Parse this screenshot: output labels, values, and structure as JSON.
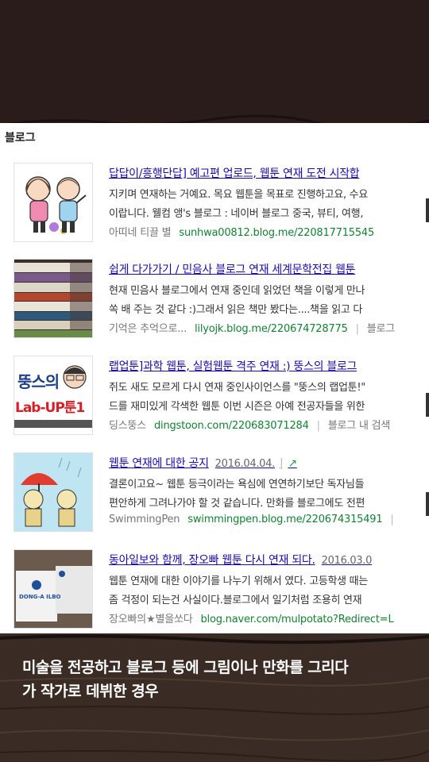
{
  "section": {
    "title": "블로그"
  },
  "results": [
    {
      "title": "답답이/흥행단답] 예고편 업로드, 웹툰 연재 도전 시작합",
      "line1": "지키며 연재하는 거예요. 목요 웹툰을 목표로 진행하고요, 수요",
      "line2": "이랍니다. 웰컴 앵's 블로그 : 네이버 블로그 중국, 뷰티, 여행,",
      "author": "아띠네 티끌 별",
      "url": "sunhwa00812.blog.me/220817715545",
      "thumb_icon": "cartoon-couple-thumbnail"
    },
    {
      "title": "쉽게 다가가기 / 민음사 블로그 연재 세계문학전집 웹툰",
      "line1": "현재 민음사 블로그에서 연재 중인데 읽었던 책을 이렇게 만나",
      "line2": "쏙 배 주는 것 같다 :)그래서 읽은 책만 봤다는....책을 읽고 다",
      "author": "기억은 추억으로...",
      "url": "lilyojk.blog.me/220674728775",
      "extra": "블로그",
      "thumb_icon": "bookshelf-thumbnail"
    },
    {
      "title": "랩업툰]과학 웹툰, 실험웹툰 격주 연재 :) 뚱스의 블로그",
      "line1": "쥐도 새도 모르게 다시 연재 중인사이언스를 \"뚱스의 랩업툰!\"",
      "line2": "드를 재미있게 각색한 웹툰 이번 시즌은 아예 전공자들을 위한",
      "author": "딩스뚱스",
      "url": "dingstoon.com/220683071284",
      "extra": "블로그 내 검색",
      "thumb_icon": "lab-up-toon-thumbnail",
      "thumb_text_top": "뚱스의",
      "thumb_text_bottom": "Lab-UP툰1"
    },
    {
      "title": "웹툰 연재에 대한 공지",
      "date": "2016.04.04.",
      "line1": "결론이고요~ 웹툰 등극이라는 욕심에 연연하기보단 독자님들",
      "line2": "편안하게 그려나가야 할 것 같습니다. 만화를 블로그에도 전편",
      "author": "SwimmingPen",
      "url": "swimmingpen.blog.me/220674315491",
      "thumb_icon": "umbrella-cartoon-thumbnail"
    },
    {
      "title": "동아일보와 함께, 장오빠 웹툰 다시 연재 되다.",
      "date": "2016.03.0",
      "line1": "웹툰 연재에 대한 이야기를 나누기 위해서 였다. 고등학생 때는",
      "line2": "좀 걱정이 되는건 사실이다.블로그에서 일기처럼 조용히 연재",
      "author": "장오빠의★별을쏘다",
      "url": "blog.naver.com/mulpotato?Redirect=L",
      "thumb_icon": "business-card-thumbnail",
      "thumb_text": "DONG-A ILBO"
    }
  ],
  "caption": {
    "line1": "미술을 전공하고 블로그 등에 그림이나 만화를 그리다",
    "line2": "가 작가로 데뷔한 경우"
  },
  "colors": {
    "link": "#1a0dab",
    "url": "#138232",
    "background": "#2c1d1d"
  }
}
